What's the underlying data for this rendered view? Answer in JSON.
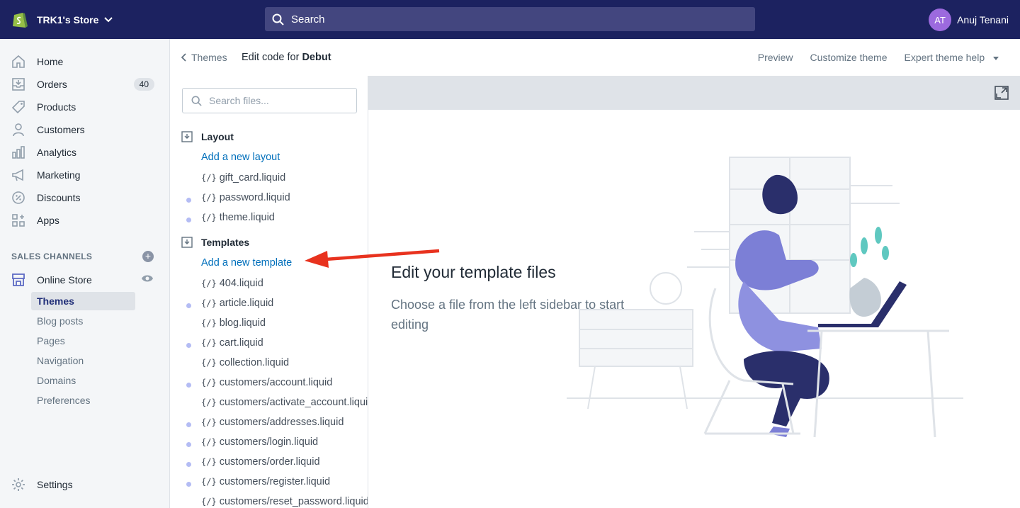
{
  "topbar": {
    "store_name": "TRK1's Store",
    "search_placeholder": "Search",
    "user_initials": "AT",
    "user_name": "Anuj Tenani"
  },
  "nav": {
    "items": [
      {
        "label": "Home",
        "icon": "home-icon"
      },
      {
        "label": "Orders",
        "icon": "orders-icon",
        "badge": "40"
      },
      {
        "label": "Products",
        "icon": "tag-icon"
      },
      {
        "label": "Customers",
        "icon": "person-icon"
      },
      {
        "label": "Analytics",
        "icon": "bar-chart-icon"
      },
      {
        "label": "Marketing",
        "icon": "megaphone-icon"
      },
      {
        "label": "Discounts",
        "icon": "discount-icon"
      },
      {
        "label": "Apps",
        "icon": "apps-icon"
      }
    ],
    "sales_channels_label": "SALES CHANNELS",
    "online_store_label": "Online Store",
    "sub_items": [
      "Themes",
      "Blog posts",
      "Pages",
      "Navigation",
      "Domains",
      "Preferences"
    ],
    "active_sub": "Themes",
    "settings_label": "Settings"
  },
  "header": {
    "back_label": "Themes",
    "title_prefix": "Edit code for ",
    "theme_name": "Debut",
    "preview_label": "Preview",
    "customize_label": "Customize theme",
    "help_label": "Expert theme help"
  },
  "files": {
    "search_placeholder": "Search files...",
    "layout_label": "Layout",
    "add_layout_label": "Add a new layout",
    "layout_files": [
      {
        "name": "gift_card.liquid",
        "modified": false
      },
      {
        "name": "password.liquid",
        "modified": true
      },
      {
        "name": "theme.liquid",
        "modified": true
      }
    ],
    "templates_label": "Templates",
    "add_template_label": "Add a new template",
    "template_files": [
      {
        "name": "404.liquid",
        "modified": false
      },
      {
        "name": "article.liquid",
        "modified": true
      },
      {
        "name": "blog.liquid",
        "modified": false
      },
      {
        "name": "cart.liquid",
        "modified": true
      },
      {
        "name": "collection.liquid",
        "modified": false
      },
      {
        "name": "customers/account.liquid",
        "modified": true
      },
      {
        "name": "customers/activate_account.liquid",
        "modified": false
      },
      {
        "name": "customers/addresses.liquid",
        "modified": true
      },
      {
        "name": "customers/login.liquid",
        "modified": true
      },
      {
        "name": "customers/order.liquid",
        "modified": true
      },
      {
        "name": "customers/register.liquid",
        "modified": true
      },
      {
        "name": "customers/reset_password.liquid",
        "modified": false
      }
    ],
    "liquid_tag": "{/}"
  },
  "editor": {
    "empty_title": "Edit your template files",
    "empty_desc": "Choose a file from the left sidebar to start editing"
  },
  "colors": {
    "topbar": "#1c2260",
    "link": "#006fbb",
    "arrow": "#e8321e",
    "illustration": "#7c7fd6"
  }
}
